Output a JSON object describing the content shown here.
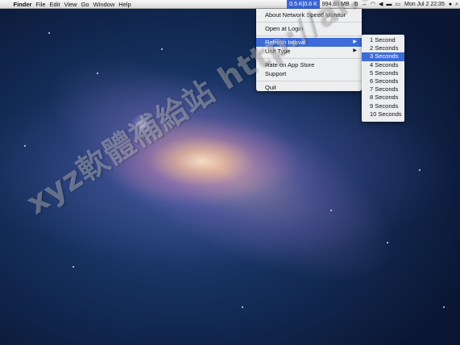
{
  "menubar": {
    "app_name": "Finder",
    "menus": [
      "File",
      "Edit",
      "View",
      "Go",
      "Window",
      "Help"
    ],
    "status": {
      "net_speed": "0.5 K|0.6 K",
      "memory": "994.60 MB",
      "clock": "Mon Jul 2 22:35"
    }
  },
  "dropdown": {
    "items": [
      "About Network Speed Monitor",
      "Open at Login",
      "Refresh Inteval",
      "Unit Type",
      "Rate on App Store",
      "Support",
      "Quit"
    ]
  },
  "submenu": {
    "items": [
      "1 Second",
      "2 Seconds",
      "3 Seconds",
      "4 Seconds",
      "5 Seconds",
      "6 Seconds",
      "7 Seconds",
      "8 Seconds",
      "9 Seconds",
      "10 Seconds"
    ],
    "selected_index": 2
  },
  "watermark": "xyz軟體補給站 http://al.to",
  "colors": {
    "highlight": "#3d6bd8",
    "menubar": "#e6e6e6"
  }
}
